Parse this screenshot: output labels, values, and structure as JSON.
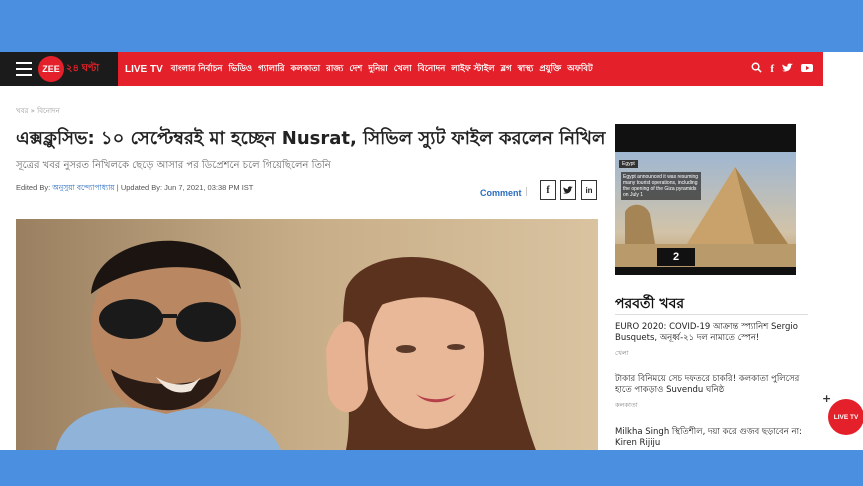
{
  "header": {
    "logo_mark": "ZEE",
    "logo_text": "২৪ ঘণ্টা",
    "nav_items": [
      "LIVE TV",
      "বাংলার নির্বাচন",
      "ভিডিও",
      "গ্যালারি",
      "কলকাতা",
      "রাজ্য",
      "দেশ",
      "দুনিয়া",
      "খেলা",
      "বিনোদন",
      "লাইফ স্টাইল",
      "ব্লগ",
      "স্বাস্থ্য",
      "প্রযুক্তি",
      "অফবিট"
    ],
    "icons": [
      "search-icon",
      "facebook-icon",
      "twitter-icon",
      "youtube-icon"
    ]
  },
  "article": {
    "breadcrumb": "খবর » বিনোদন",
    "headline": "এক্সক্লুসিভ: ১০ সেপ্টেম্বরই মা হচ্ছেন Nusrat, সিভিল স্যুট ফাইল করলেন নিখিল",
    "subhead": "সূত্রের খবর নুসরত নিখিলকে ছেড়ে আসার পর ডিপ্রেশনে চলে গিয়েছিলেন তিনি",
    "edited_by_label": "Edited By:",
    "author": "অনুসুয়া বন্দ্যোপাধ্যায়",
    "updated": "| Updated By: Jun 7, 2021, 03:38 PM IST",
    "comment_label": "Comment",
    "separator": "|",
    "share": [
      "f",
      "t",
      "in"
    ]
  },
  "ad": {
    "label": "Egypt",
    "caption": "Egypt announced it was resuming many tourist operations, including the opening of the Giza pyramids on July 1",
    "slide_number": "2"
  },
  "sidebar": {
    "title": "পরবর্তী খবর",
    "items": [
      {
        "text": "EURO 2020: COVID-19 আক্রান্ত স্প্যানিশ Sergio Busquets, অনূর্ধ্ব-২১ দল নামাতে স্পেন!",
        "category": "খেলা"
      },
      {
        "text": "টাকার বিনিময়ে সেচ দফতরে চাকরি! কলকাতা পুলিসের হাতে পাকড়াও Suvendu ঘনিষ্ঠ",
        "category": "কলকাতা"
      },
      {
        "text": "Milkha Singh স্থিতিশীল, দয়া করে গুজব ছড়াবেন না: Kiren Rijiju",
        "category": ""
      }
    ]
  },
  "live_button": "LIVE TV",
  "colors": {
    "brand_red": "#e4212a",
    "frame_blue": "#4a8fe0",
    "link_blue": "#2a6dc0"
  }
}
